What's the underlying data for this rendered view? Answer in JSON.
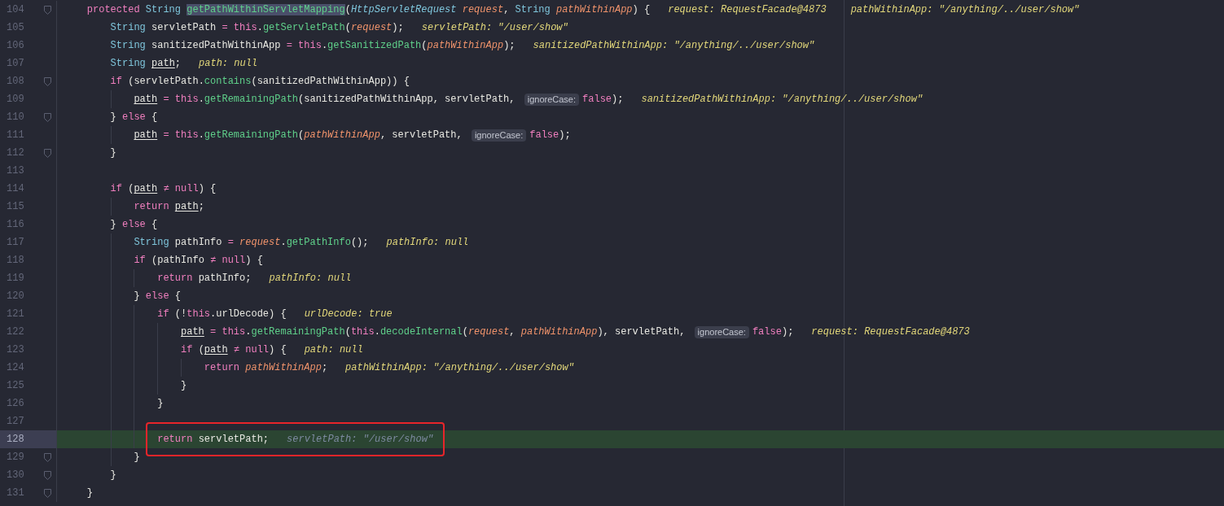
{
  "lines": [
    {
      "number": "104",
      "fold": true,
      "current": false,
      "boxed": false,
      "tokens": [
        {
          "kind": "keyword",
          "text": "protected "
        },
        {
          "kind": "type",
          "text": "String "
        },
        {
          "kind": "function_marked",
          "text": "getPathWithinServletMapping"
        },
        {
          "kind": "plain",
          "text": "("
        },
        {
          "kind": "type_italic",
          "text": "HttpServletRequest "
        },
        {
          "kind": "param",
          "text": "request"
        },
        {
          "kind": "plain",
          "text": ", "
        },
        {
          "kind": "type",
          "text": "String "
        },
        {
          "kind": "param",
          "text": "pathWithinApp"
        },
        {
          "kind": "plain",
          "text": ") {"
        }
      ],
      "debug": [
        "request: RequestFacade@4873",
        "pathWithinApp: \"/anything/../user/show\""
      ]
    },
    {
      "number": "105",
      "fold": false,
      "current": false,
      "boxed": false,
      "tokens": [
        {
          "kind": "type",
          "text": "String "
        },
        {
          "kind": "plain",
          "text": "servletPath "
        },
        {
          "kind": "keyword",
          "text": "= this"
        },
        {
          "kind": "plain",
          "text": "."
        },
        {
          "kind": "function",
          "text": "getServletPath"
        },
        {
          "kind": "plain",
          "text": "("
        },
        {
          "kind": "param",
          "text": "request"
        },
        {
          "kind": "plain",
          "text": ");"
        }
      ],
      "debug": [
        "servletPath: \"/user/show\""
      ]
    },
    {
      "number": "106",
      "fold": false,
      "current": false,
      "boxed": false,
      "tokens": [
        {
          "kind": "type",
          "text": "String "
        },
        {
          "kind": "plain",
          "text": "sanitizedPathWithinApp "
        },
        {
          "kind": "keyword",
          "text": "= this"
        },
        {
          "kind": "plain",
          "text": "."
        },
        {
          "kind": "function",
          "text": "getSanitizedPath"
        },
        {
          "kind": "plain",
          "text": "("
        },
        {
          "kind": "param",
          "text": "pathWithinApp"
        },
        {
          "kind": "plain",
          "text": ");"
        }
      ],
      "debug": [
        "sanitizedPathWithinApp: \"/anything/../user/show\""
      ]
    },
    {
      "number": "107",
      "fold": false,
      "current": false,
      "boxed": false,
      "tokens": [
        {
          "kind": "type",
          "text": "String "
        },
        {
          "kind": "var",
          "text": "path"
        },
        {
          "kind": "plain",
          "text": ";"
        }
      ],
      "debug": [
        "path: null"
      ]
    },
    {
      "number": "108",
      "fold": true,
      "current": false,
      "boxed": false,
      "tokens": [
        {
          "kind": "keyword",
          "text": "if "
        },
        {
          "kind": "plain",
          "text": "(servletPath."
        },
        {
          "kind": "function",
          "text": "contains"
        },
        {
          "kind": "plain",
          "text": "(sanitizedPathWithinApp)) {"
        }
      ]
    },
    {
      "number": "109",
      "fold": false,
      "current": false,
      "boxed": false,
      "tokens": [
        {
          "kind": "var",
          "text": "path"
        },
        {
          "kind": "keyword",
          "text": " = this"
        },
        {
          "kind": "plain",
          "text": "."
        },
        {
          "kind": "function",
          "text": "getRemainingPath"
        },
        {
          "kind": "plain",
          "text": "(sanitizedPathWithinApp, servletPath, "
        },
        {
          "kind": "hint",
          "text": "ignoreCase:"
        },
        {
          "kind": "keyword",
          "text": "false"
        },
        {
          "kind": "plain",
          "text": ");"
        }
      ],
      "debug": [
        "sanitizedPathWithinApp: \"/anything/../user/show\""
      ]
    },
    {
      "number": "110",
      "fold": true,
      "current": false,
      "boxed": false,
      "tokens": [
        {
          "kind": "plain",
          "text": "} "
        },
        {
          "kind": "keyword",
          "text": "else "
        },
        {
          "kind": "plain",
          "text": "{"
        }
      ]
    },
    {
      "number": "111",
      "fold": false,
      "current": false,
      "boxed": false,
      "tokens": [
        {
          "kind": "var",
          "text": "path"
        },
        {
          "kind": "keyword",
          "text": " = this"
        },
        {
          "kind": "plain",
          "text": "."
        },
        {
          "kind": "function",
          "text": "getRemainingPath"
        },
        {
          "kind": "plain",
          "text": "("
        },
        {
          "kind": "param",
          "text": "pathWithinApp"
        },
        {
          "kind": "plain",
          "text": ", servletPath, "
        },
        {
          "kind": "hint",
          "text": "ignoreCase:"
        },
        {
          "kind": "keyword",
          "text": "false"
        },
        {
          "kind": "plain",
          "text": ");"
        }
      ]
    },
    {
      "number": "112",
      "fold": true,
      "current": false,
      "boxed": false,
      "tokens": [
        {
          "kind": "plain",
          "text": "}"
        }
      ]
    },
    {
      "number": "113",
      "fold": false,
      "current": false,
      "boxed": false
    },
    {
      "number": "114",
      "fold": false,
      "current": false,
      "boxed": false,
      "tokens": [
        {
          "kind": "keyword",
          "text": "if "
        },
        {
          "kind": "plain",
          "text": "("
        },
        {
          "kind": "var",
          "text": "path"
        },
        {
          "kind": "keyword",
          "text": " ≠ null"
        },
        {
          "kind": "plain",
          "text": ") {"
        }
      ]
    },
    {
      "number": "115",
      "fold": false,
      "current": false,
      "boxed": false,
      "tokens": [
        {
          "kind": "keyword",
          "text": "return "
        },
        {
          "kind": "var",
          "text": "path"
        },
        {
          "kind": "plain",
          "text": ";"
        }
      ]
    },
    {
      "number": "116",
      "fold": false,
      "current": false,
      "boxed": false,
      "tokens": [
        {
          "kind": "plain",
          "text": "} "
        },
        {
          "kind": "keyword",
          "text": "else "
        },
        {
          "kind": "plain",
          "text": "{"
        }
      ]
    },
    {
      "number": "117",
      "fold": false,
      "current": false,
      "boxed": false,
      "tokens": [
        {
          "kind": "type",
          "text": "String "
        },
        {
          "kind": "plain",
          "text": "pathInfo "
        },
        {
          "kind": "keyword",
          "text": "= "
        },
        {
          "kind": "param",
          "text": "request"
        },
        {
          "kind": "plain",
          "text": "."
        },
        {
          "kind": "function",
          "text": "getPathInfo"
        },
        {
          "kind": "plain",
          "text": "();"
        }
      ],
      "debug": [
        "pathInfo: null"
      ]
    },
    {
      "number": "118",
      "fold": false,
      "current": false,
      "boxed": false,
      "tokens": [
        {
          "kind": "keyword",
          "text": "if "
        },
        {
          "kind": "plain",
          "text": "(pathInfo "
        },
        {
          "kind": "keyword",
          "text": "≠ null"
        },
        {
          "kind": "plain",
          "text": ") {"
        }
      ]
    },
    {
      "number": "119",
      "fold": false,
      "current": false,
      "boxed": false,
      "tokens": [
        {
          "kind": "keyword",
          "text": "return "
        },
        {
          "kind": "plain",
          "text": "pathInfo;"
        }
      ],
      "debug": [
        "pathInfo: null"
      ]
    },
    {
      "number": "120",
      "fold": false,
      "current": false,
      "boxed": false,
      "tokens": [
        {
          "kind": "plain",
          "text": "} "
        },
        {
          "kind": "keyword",
          "text": "else "
        },
        {
          "kind": "plain",
          "text": "{"
        }
      ]
    },
    {
      "number": "121",
      "fold": false,
      "current": false,
      "boxed": false,
      "tokens": [
        {
          "kind": "keyword",
          "text": "if "
        },
        {
          "kind": "plain",
          "text": "(!"
        },
        {
          "kind": "keyword",
          "text": "this"
        },
        {
          "kind": "plain",
          "text": ".urlDecode) {"
        }
      ],
      "debug": [
        "urlDecode: true"
      ]
    },
    {
      "number": "122",
      "fold": false,
      "current": false,
      "boxed": false,
      "tokens": [
        {
          "kind": "var",
          "text": "path"
        },
        {
          "kind": "keyword",
          "text": " = this"
        },
        {
          "kind": "plain",
          "text": "."
        },
        {
          "kind": "function",
          "text": "getRemainingPath"
        },
        {
          "kind": "plain",
          "text": "("
        },
        {
          "kind": "keyword",
          "text": "this"
        },
        {
          "kind": "plain",
          "text": "."
        },
        {
          "kind": "function",
          "text": "decodeInternal"
        },
        {
          "kind": "plain",
          "text": "("
        },
        {
          "kind": "param",
          "text": "request"
        },
        {
          "kind": "plain",
          "text": ", "
        },
        {
          "kind": "param",
          "text": "pathWithinApp"
        },
        {
          "kind": "plain",
          "text": "), servletPath, "
        },
        {
          "kind": "hint",
          "text": "ignoreCase:"
        },
        {
          "kind": "keyword",
          "text": "false"
        },
        {
          "kind": "plain",
          "text": ");"
        }
      ],
      "debug": [
        "request: RequestFacade@4873"
      ]
    },
    {
      "number": "123",
      "fold": false,
      "current": false,
      "boxed": false,
      "tokens": [
        {
          "kind": "keyword",
          "text": "if "
        },
        {
          "kind": "plain",
          "text": "("
        },
        {
          "kind": "var",
          "text": "path"
        },
        {
          "kind": "keyword",
          "text": " ≠ null"
        },
        {
          "kind": "plain",
          "text": ") {"
        }
      ],
      "debug": [
        "path: null"
      ]
    },
    {
      "number": "124",
      "fold": false,
      "current": false,
      "boxed": false,
      "tokens": [
        {
          "kind": "keyword",
          "text": "return "
        },
        {
          "kind": "param",
          "text": "pathWithinApp"
        },
        {
          "kind": "plain",
          "text": ";"
        }
      ],
      "debug": [
        "pathWithinApp: \"/anything/../user/show\""
      ]
    },
    {
      "number": "125",
      "fold": false,
      "current": false,
      "boxed": false,
      "tokens": [
        {
          "kind": "plain",
          "text": "}"
        }
      ]
    },
    {
      "number": "126",
      "fold": false,
      "current": false,
      "boxed": false,
      "tokens": [
        {
          "kind": "plain",
          "text": "}"
        }
      ]
    },
    {
      "number": "127",
      "fold": false,
      "current": false,
      "boxed": false
    },
    {
      "number": "128",
      "fold": false,
      "current": true,
      "boxed": true,
      "tokens": [
        {
          "kind": "keyword",
          "text": "return "
        },
        {
          "kind": "plain",
          "text": "servletPath;"
        }
      ],
      "debug": [
        "servletPath: \"/user/show\""
      ]
    },
    {
      "number": "129",
      "fold": true,
      "current": false,
      "boxed": false,
      "tokens": [
        {
          "kind": "plain",
          "text": "}"
        }
      ]
    },
    {
      "number": "130",
      "fold": true,
      "current": false,
      "boxed": false,
      "tokens": [
        {
          "kind": "plain",
          "text": "}"
        }
      ]
    },
    {
      "number": "131",
      "fold": true,
      "current": false,
      "boxed": false,
      "tokens": [
        {
          "kind": "plain",
          "text": "}"
        }
      ]
    }
  ]
}
